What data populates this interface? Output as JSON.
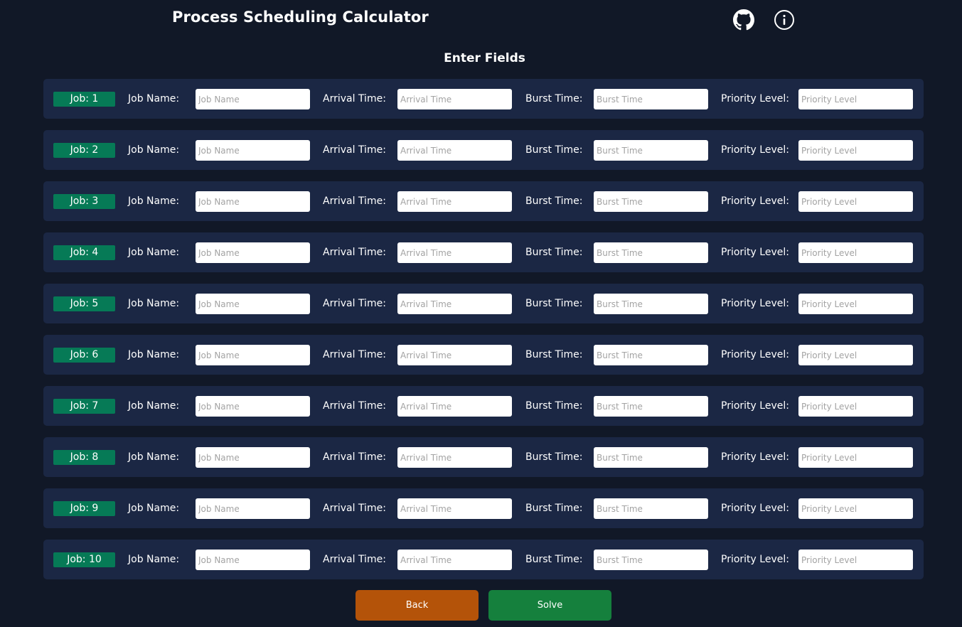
{
  "header": {
    "title": "Process Scheduling Calculator"
  },
  "section_title": "Enter Fields",
  "labels": {
    "job_name": "Job Name:",
    "arrival_time": "Arrival Time:",
    "burst_time": "Burst Time:",
    "priority_level": "Priority Level:"
  },
  "placeholders": {
    "job_name": "Job Name",
    "arrival_time": "Arrival Time",
    "burst_time": "Burst Time",
    "priority_level": "Priority Level"
  },
  "jobs": [
    {
      "badge": "Job: 1"
    },
    {
      "badge": "Job: 2"
    },
    {
      "badge": "Job: 3"
    },
    {
      "badge": "Job: 4"
    },
    {
      "badge": "Job: 5"
    },
    {
      "badge": "Job: 6"
    },
    {
      "badge": "Job: 7"
    },
    {
      "badge": "Job: 8"
    },
    {
      "badge": "Job: 9"
    },
    {
      "badge": "Job: 10"
    }
  ],
  "buttons": {
    "back": "Back",
    "solve": "Solve"
  },
  "icons": {
    "github": "github-icon",
    "info": "info-icon"
  },
  "colors": {
    "background": "#111827",
    "row": "#1b2744",
    "badge": "#067a56",
    "back": "#b45309",
    "solve": "#15803d"
  }
}
